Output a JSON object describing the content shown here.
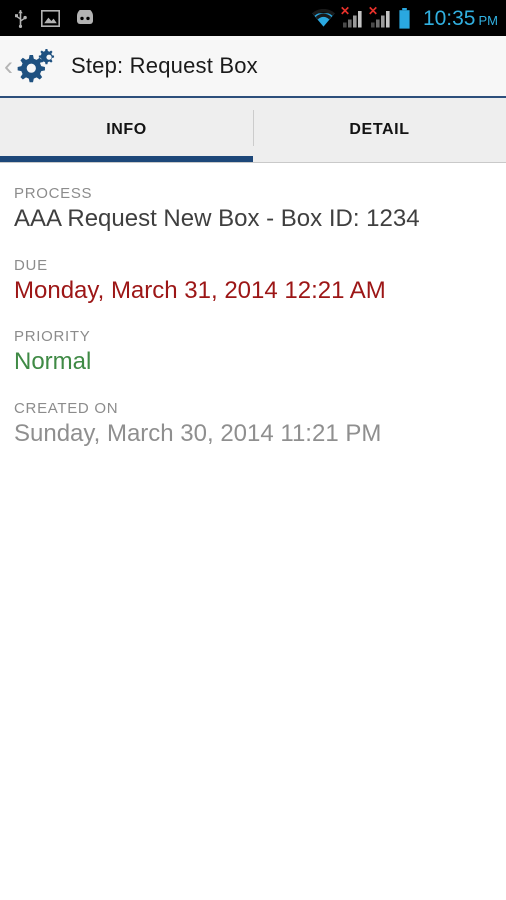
{
  "statusbar": {
    "icons_left": [
      "usb-icon",
      "screenshot-image-icon",
      "android-head-icon"
    ],
    "icons_right": [
      "wifi-icon",
      "signal-bars-1-icon",
      "signal-bars-2-icon",
      "battery-icon"
    ],
    "time": "10:35",
    "ampm": "PM",
    "time_color": "#31b0e0",
    "signal_error_mark": "✕"
  },
  "header": {
    "back_label": "‹",
    "icon": "gears-icon",
    "title": "Step: Request Box",
    "accent_color": "#2d4f7c",
    "icon_color": "#1f5180"
  },
  "tabs": [
    {
      "label": "INFO",
      "active": true
    },
    {
      "label": "DETAIL",
      "active": false
    }
  ],
  "fields": [
    {
      "label": "PROCESS",
      "value": "AAA Request New Box - Box ID: 1234",
      "color": "#3f3f3f"
    },
    {
      "label": "DUE",
      "value": "Monday, March 31, 2014 12:21 AM",
      "color": "#9c1616"
    },
    {
      "label": "PRIORITY",
      "value": "Normal",
      "color": "#3f8a45"
    },
    {
      "label": "CREATED ON",
      "value": "Sunday, March 30, 2014 11:21 PM",
      "color": "#8f8f8f"
    }
  ]
}
